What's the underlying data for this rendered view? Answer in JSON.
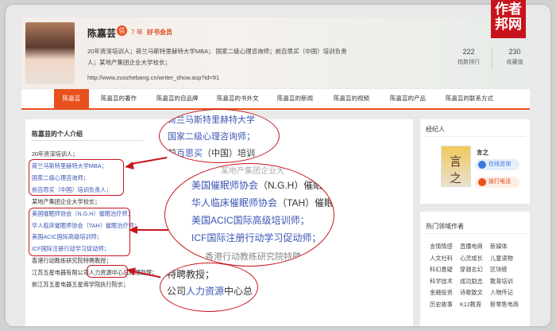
{
  "watermark": {
    "line1": "作者",
    "line2": "邦网"
  },
  "profile": {
    "name": "陈嘉芸",
    "vip_badge": "信",
    "years": "7 年",
    "separator": "|",
    "member": "好书会员",
    "bio_line1": "20年资深培训人；荷兰马斯特里赫特大学MBA；  国家二级心理咨询师；前百思买（中国）培训负责",
    "bio_line2": "人；某地产集团企业大学校长；",
    "url": "http://www.zuozhebang.cn/writer_show.asp?id=91",
    "stats": [
      {
        "value": "222",
        "label": "指数排行"
      },
      {
        "value": "230",
        "label": "收藏值"
      }
    ]
  },
  "nav": {
    "items": [
      "陈嘉芸",
      "陈嘉芸的著作",
      "陈嘉芸的自品牌",
      "陈嘉芸的书外文",
      "陈嘉芸的新闻",
      "陈嘉芸的视频",
      "陈嘉芸的产品",
      "陈嘉芸的联系方式"
    ]
  },
  "intro": {
    "title": "陈嘉芸的个人介绍",
    "lines": [
      "20年资深培训人；",
      "荷兰马斯特里赫特大学MBA；",
      "国家二级心理咨询师；",
      "前百思买（中国）培训负责人；",
      "某地产集团企业大学校长；",
      "美国催眠师协会（N.G.H）催眠治疗师；",
      "华人临床催眠师协会（TAH）催眠治疗师；",
      "美国ACIC国际高级培训师；",
      "ICF国际注册行动学习促动师；",
      "香港行动教练研究院特聘教授；",
      "江苏五星电器有限公司人力资源中心总经理助理；",
      "前江苏五星电器五星商学院执行院长；"
    ]
  },
  "zoom1": {
    "line1": "荷兰马斯特里赫特大学",
    "line2": "国家二级心理咨询师；",
    "line3_a": "前",
    "line3_b": "百思买",
    "line3_c": "（中国）培训"
  },
  "zoom2": {
    "line0": "某地产集团企业大",
    "line1_a": "美国催眠师协会",
    "line1_b": "（N.G.H）催眠",
    "line2_a": "华人临床催眠师协会",
    "line2_b": "（TAH）催眠",
    "line3": "美国ACIC国际高级培训师；",
    "line4": "ICF国际注册行动学习促动师；",
    "line5": "香港行动教练研究院特聘"
  },
  "zoom3": {
    "line1": "特聘教授；",
    "line2_a": "公司",
    "line2_b": "人力资源",
    "line2_c": "中心总"
  },
  "agent": {
    "title": "经纪人",
    "book_text": "言之",
    "name": "言之",
    "btn_online": "在线咨询",
    "btn_call": "拨打电话"
  },
  "hot": {
    "title": "热门领域作者",
    "tags": [
      [
        "言情情感",
        "直播电商",
        "新媒体"
      ],
      [
        "人文社科",
        "心灵成长",
        "儿童读物"
      ],
      [
        "科幻悬疑",
        "穿越玄幻",
        "区块链"
      ],
      [
        "科学技术",
        "成功励志",
        "教育培训"
      ],
      [
        "金融投资",
        "诗歌散文",
        "人物传记"
      ],
      [
        "历史故事",
        "K12教育",
        "新零售电商"
      ]
    ]
  },
  "colors": {
    "accent": "#e8501d",
    "annotation_red": "#c8141d",
    "link_blue": "#3b55b5"
  }
}
